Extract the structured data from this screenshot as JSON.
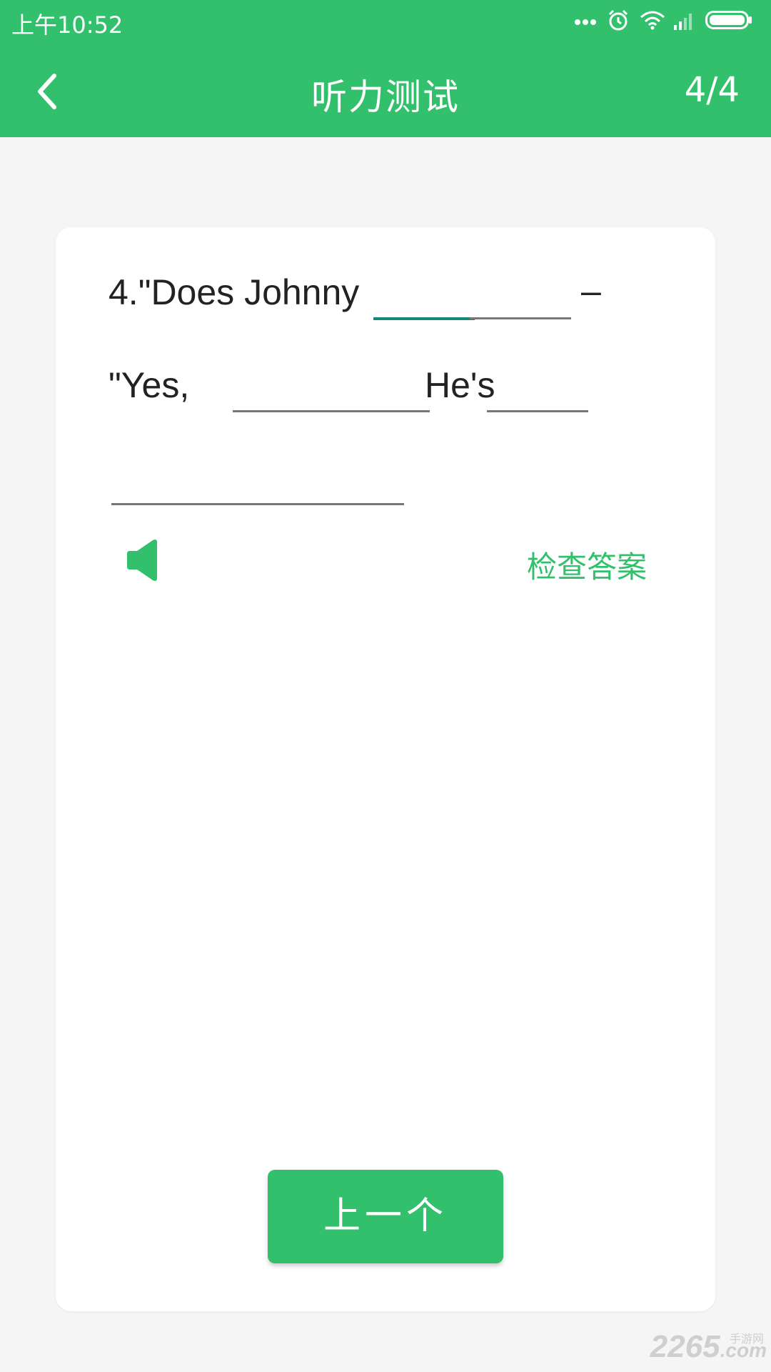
{
  "status_bar": {
    "time": "上午10:52",
    "icons": [
      "more-dots-icon",
      "alarm-icon",
      "wifi-icon",
      "signal-icon",
      "battery-icon"
    ]
  },
  "toolbar": {
    "title": "听力测试",
    "progress": "4/4",
    "back_icon": "chevron-left-icon"
  },
  "question": {
    "line1_text": "4.\"Does Johnny",
    "line1_dash": "–",
    "line2_start": "\"Yes,",
    "line2_mid": "He's"
  },
  "actions": {
    "speaker_icon": "speaker-icon",
    "check_answer": "检查答案",
    "prev_button": "上一个"
  },
  "watermark": {
    "brand": "2265",
    "suffix": ".com",
    "site_label": "手游网"
  },
  "colors": {
    "primary": "#33c06d",
    "active_blank": "#128a7a",
    "background": "#f5f5f5"
  }
}
